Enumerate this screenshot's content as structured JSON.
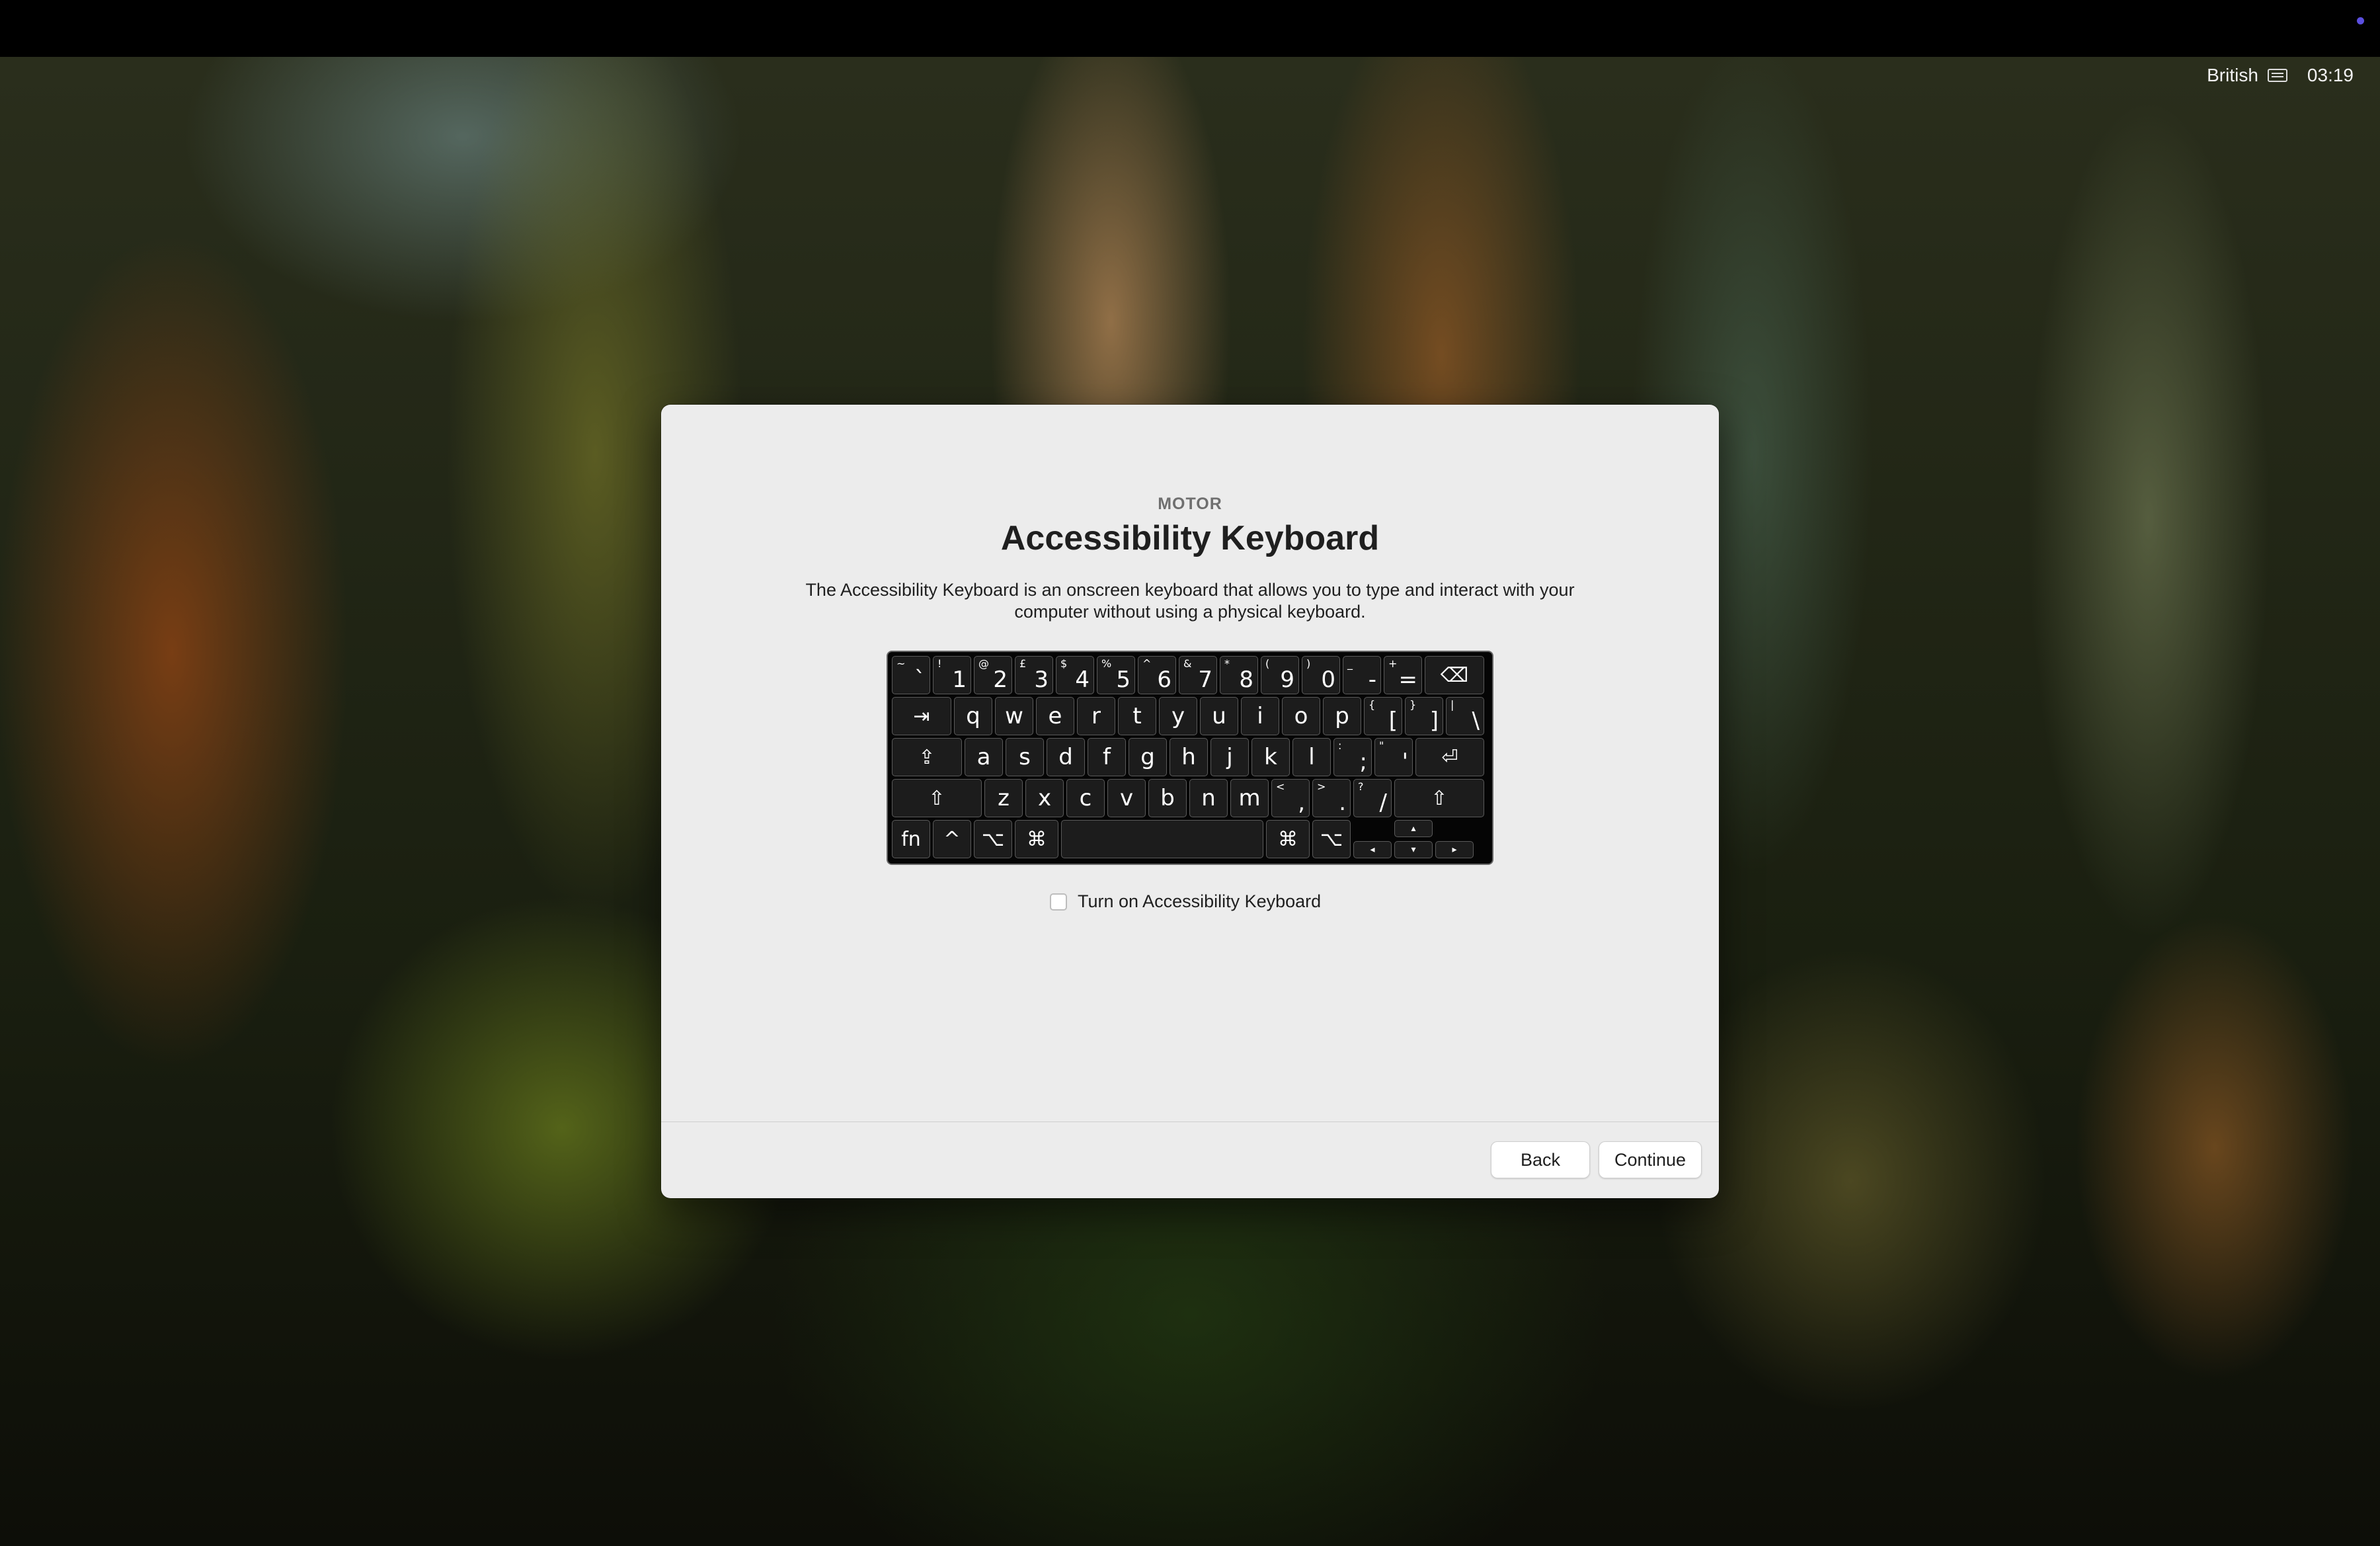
{
  "status_bar": {
    "input_source": "British",
    "keyboard_icon": "keyboard-icon",
    "time": "03:19"
  },
  "dialog": {
    "kicker": "MOTOR",
    "title": "Accessibility Keyboard",
    "description": "The Accessibility Keyboard is an onscreen keyboard that allows you to type and interact with your computer without using a physical keyboard.",
    "checkbox_label": "Turn on Accessibility Keyboard",
    "checkbox_checked": false,
    "back_label": "Back",
    "continue_label": "Continue"
  },
  "keyboard": {
    "rows": [
      [
        {
          "shift": "~",
          "main": "`"
        },
        {
          "shift": "!",
          "main": "1"
        },
        {
          "shift": "@",
          "main": "2"
        },
        {
          "shift": "£",
          "main": "3"
        },
        {
          "shift": "$",
          "main": "4"
        },
        {
          "shift": "%",
          "main": "5"
        },
        {
          "shift": "^",
          "main": "6"
        },
        {
          "shift": "&",
          "main": "7"
        },
        {
          "shift": "*",
          "main": "8"
        },
        {
          "shift": "(",
          "main": "9"
        },
        {
          "shift": ")",
          "main": "0"
        },
        {
          "shift": "_",
          "main": "-"
        },
        {
          "shift": "+",
          "main": "="
        },
        {
          "main": "⌫",
          "name": "delete-key"
        }
      ],
      [
        {
          "main": "⇥",
          "name": "tab-key"
        },
        {
          "main": "q"
        },
        {
          "main": "w"
        },
        {
          "main": "e"
        },
        {
          "main": "r"
        },
        {
          "main": "t"
        },
        {
          "main": "y"
        },
        {
          "main": "u"
        },
        {
          "main": "i"
        },
        {
          "main": "o"
        },
        {
          "main": "p"
        },
        {
          "shift": "{",
          "main": "["
        },
        {
          "shift": "}",
          "main": "]"
        },
        {
          "shift": "|",
          "main": "\\"
        }
      ],
      [
        {
          "main": "⇪",
          "name": "caps-lock-key"
        },
        {
          "main": "a"
        },
        {
          "main": "s"
        },
        {
          "main": "d"
        },
        {
          "main": "f"
        },
        {
          "main": "g"
        },
        {
          "main": "h"
        },
        {
          "main": "j"
        },
        {
          "main": "k"
        },
        {
          "main": "l"
        },
        {
          "shift": ":",
          "main": ";"
        },
        {
          "shift": "\"",
          "main": "'"
        },
        {
          "main": "⏎",
          "name": "return-key"
        }
      ],
      [
        {
          "main": "⇧",
          "name": "left-shift-key"
        },
        {
          "main": "z"
        },
        {
          "main": "x"
        },
        {
          "main": "c"
        },
        {
          "main": "v"
        },
        {
          "main": "b"
        },
        {
          "main": "n"
        },
        {
          "main": "m"
        },
        {
          "shift": "<",
          "main": ","
        },
        {
          "shift": ">",
          "main": "."
        },
        {
          "shift": "?",
          "main": "/"
        },
        {
          "main": "⇧",
          "name": "right-shift-key"
        }
      ],
      [
        {
          "main": "fn",
          "name": "fn-key"
        },
        {
          "main": "^",
          "name": "control-key"
        },
        {
          "main": "⌥",
          "name": "left-option-key"
        },
        {
          "main": "⌘",
          "name": "left-command-key"
        },
        {
          "main": "",
          "name": "space-bar"
        },
        {
          "main": "⌘",
          "name": "right-command-key"
        },
        {
          "main": "⌥",
          "name": "right-option-key"
        },
        {
          "main": "▴",
          "name": "arrow-up-key"
        },
        {
          "main": "◂",
          "name": "arrow-left-key"
        },
        {
          "main": "▾",
          "name": "arrow-down-key"
        },
        {
          "main": "▸",
          "name": "arrow-right-key"
        }
      ]
    ]
  }
}
